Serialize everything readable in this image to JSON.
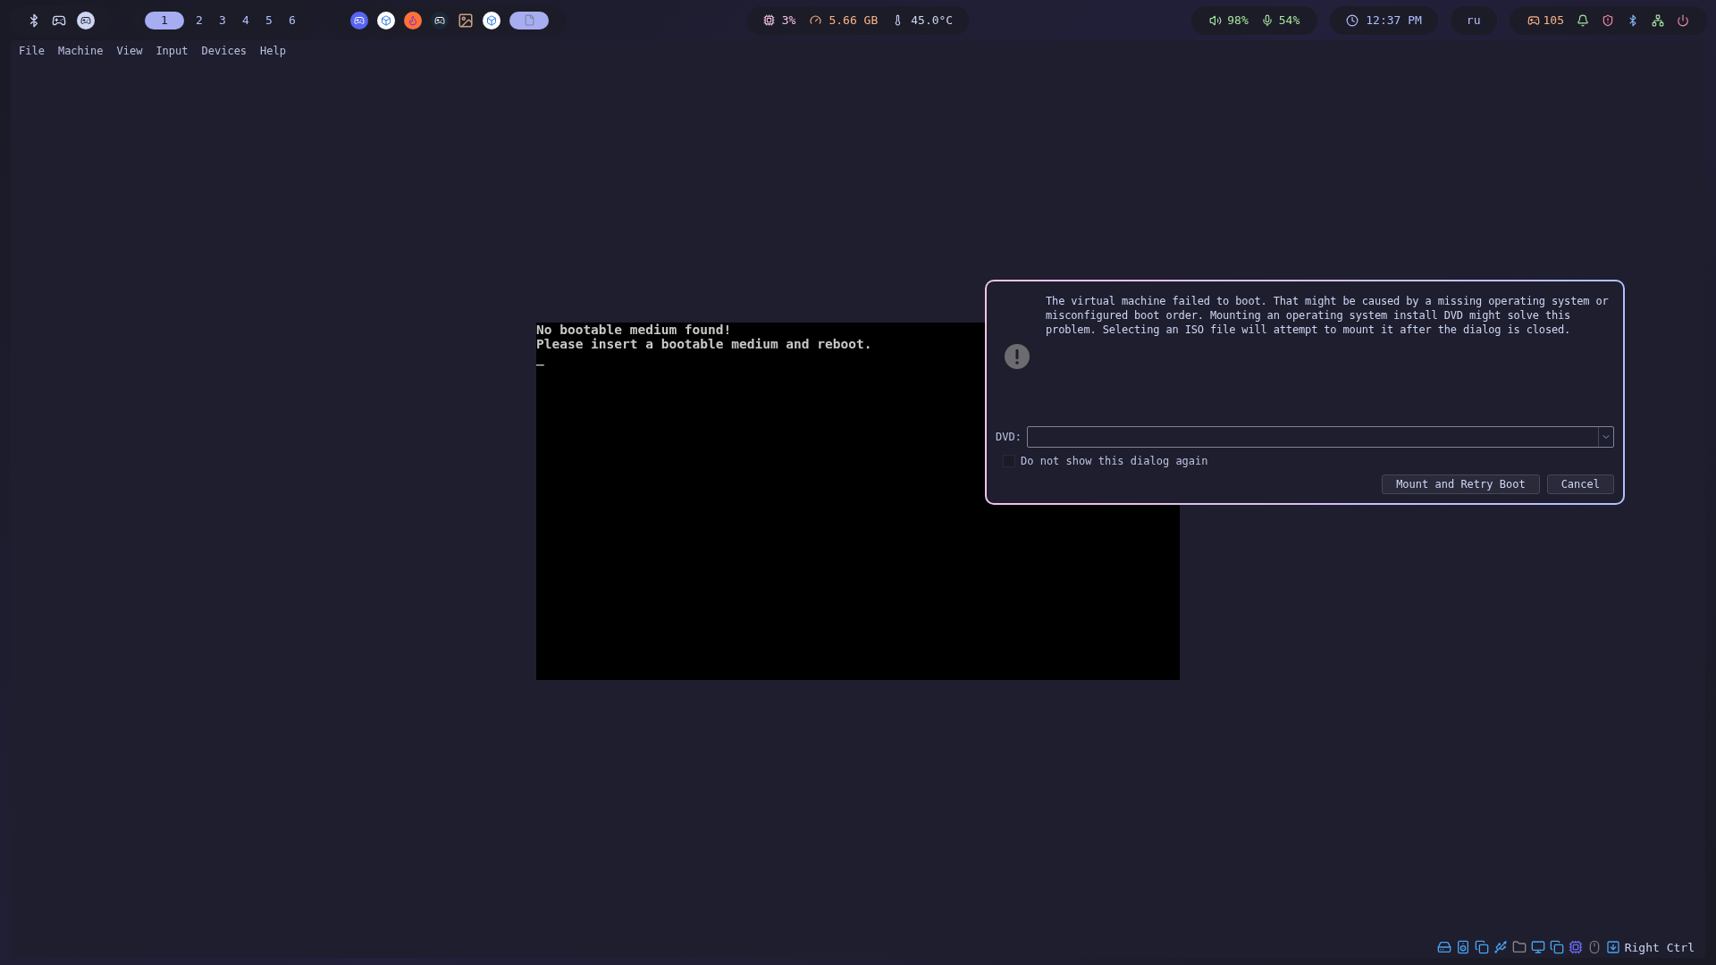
{
  "top_bar": {
    "workspaces": [
      {
        "label": "1",
        "selected": true
      },
      {
        "label": "2",
        "selected": false
      },
      {
        "label": "3",
        "selected": false
      },
      {
        "label": "4",
        "selected": false
      },
      {
        "label": "5",
        "selected": false
      },
      {
        "label": "6",
        "selected": false
      }
    ],
    "cpu": "3%",
    "memory": "5.66 GB",
    "temperature": "45.0°C",
    "volume": "98%",
    "microphone": "54%",
    "clock": "12:37 PM",
    "keyboard_layout": "ru",
    "updates": "105"
  },
  "menu_bar": [
    "File",
    "Machine",
    "View",
    "Input",
    "Devices",
    "Help"
  ],
  "vm_screen": {
    "lines": [
      "No bootable medium found!",
      "Please insert a bootable medium and reboot.",
      "_"
    ]
  },
  "dialog": {
    "message": "The virtual machine failed to boot. That might be caused by a missing operating system or misconfigured boot order. Mounting an operating system install DVD might solve this problem. Selecting an ISO file will attempt to mount it after the dialog is closed.",
    "dvd_label": "DVD:",
    "dont_show_again": {
      "label": "Do not show this dialog again",
      "checked": false
    },
    "buttons": [
      "Mount and Retry Boot",
      "Cancel"
    ]
  },
  "status_bar": {
    "host_key": "Right Ctrl"
  }
}
